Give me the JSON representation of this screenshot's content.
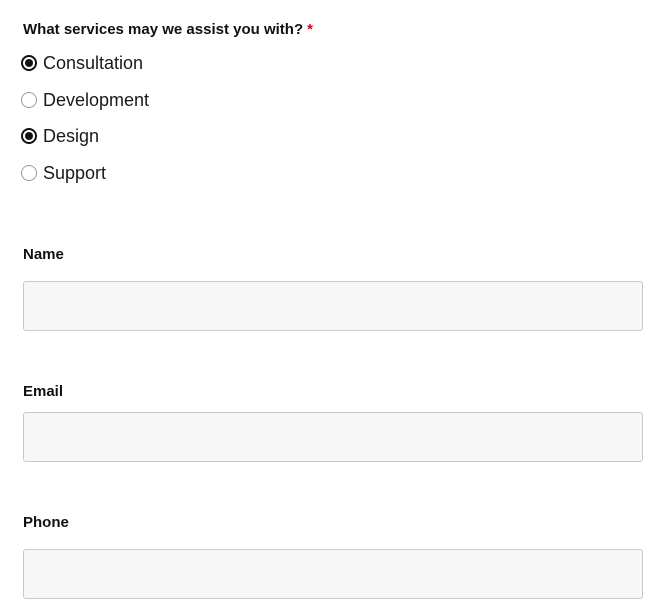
{
  "services_question": {
    "label": "What services may we assist you with?",
    "required_marker": "*",
    "options": [
      {
        "label": "Consultation",
        "checked": true
      },
      {
        "label": "Development",
        "checked": false
      },
      {
        "label": "Design",
        "checked": true
      },
      {
        "label": "Support",
        "checked": false
      }
    ]
  },
  "fields": {
    "name": {
      "label": "Name",
      "value": "",
      "placeholder": ""
    },
    "email": {
      "label": "Email",
      "value": "",
      "placeholder": ""
    },
    "phone": {
      "label": "Phone",
      "value": "",
      "placeholder": ""
    }
  },
  "colors": {
    "required": "#d0021b",
    "input_background": "#f7f7f7",
    "input_border": "#c8c8c8"
  }
}
